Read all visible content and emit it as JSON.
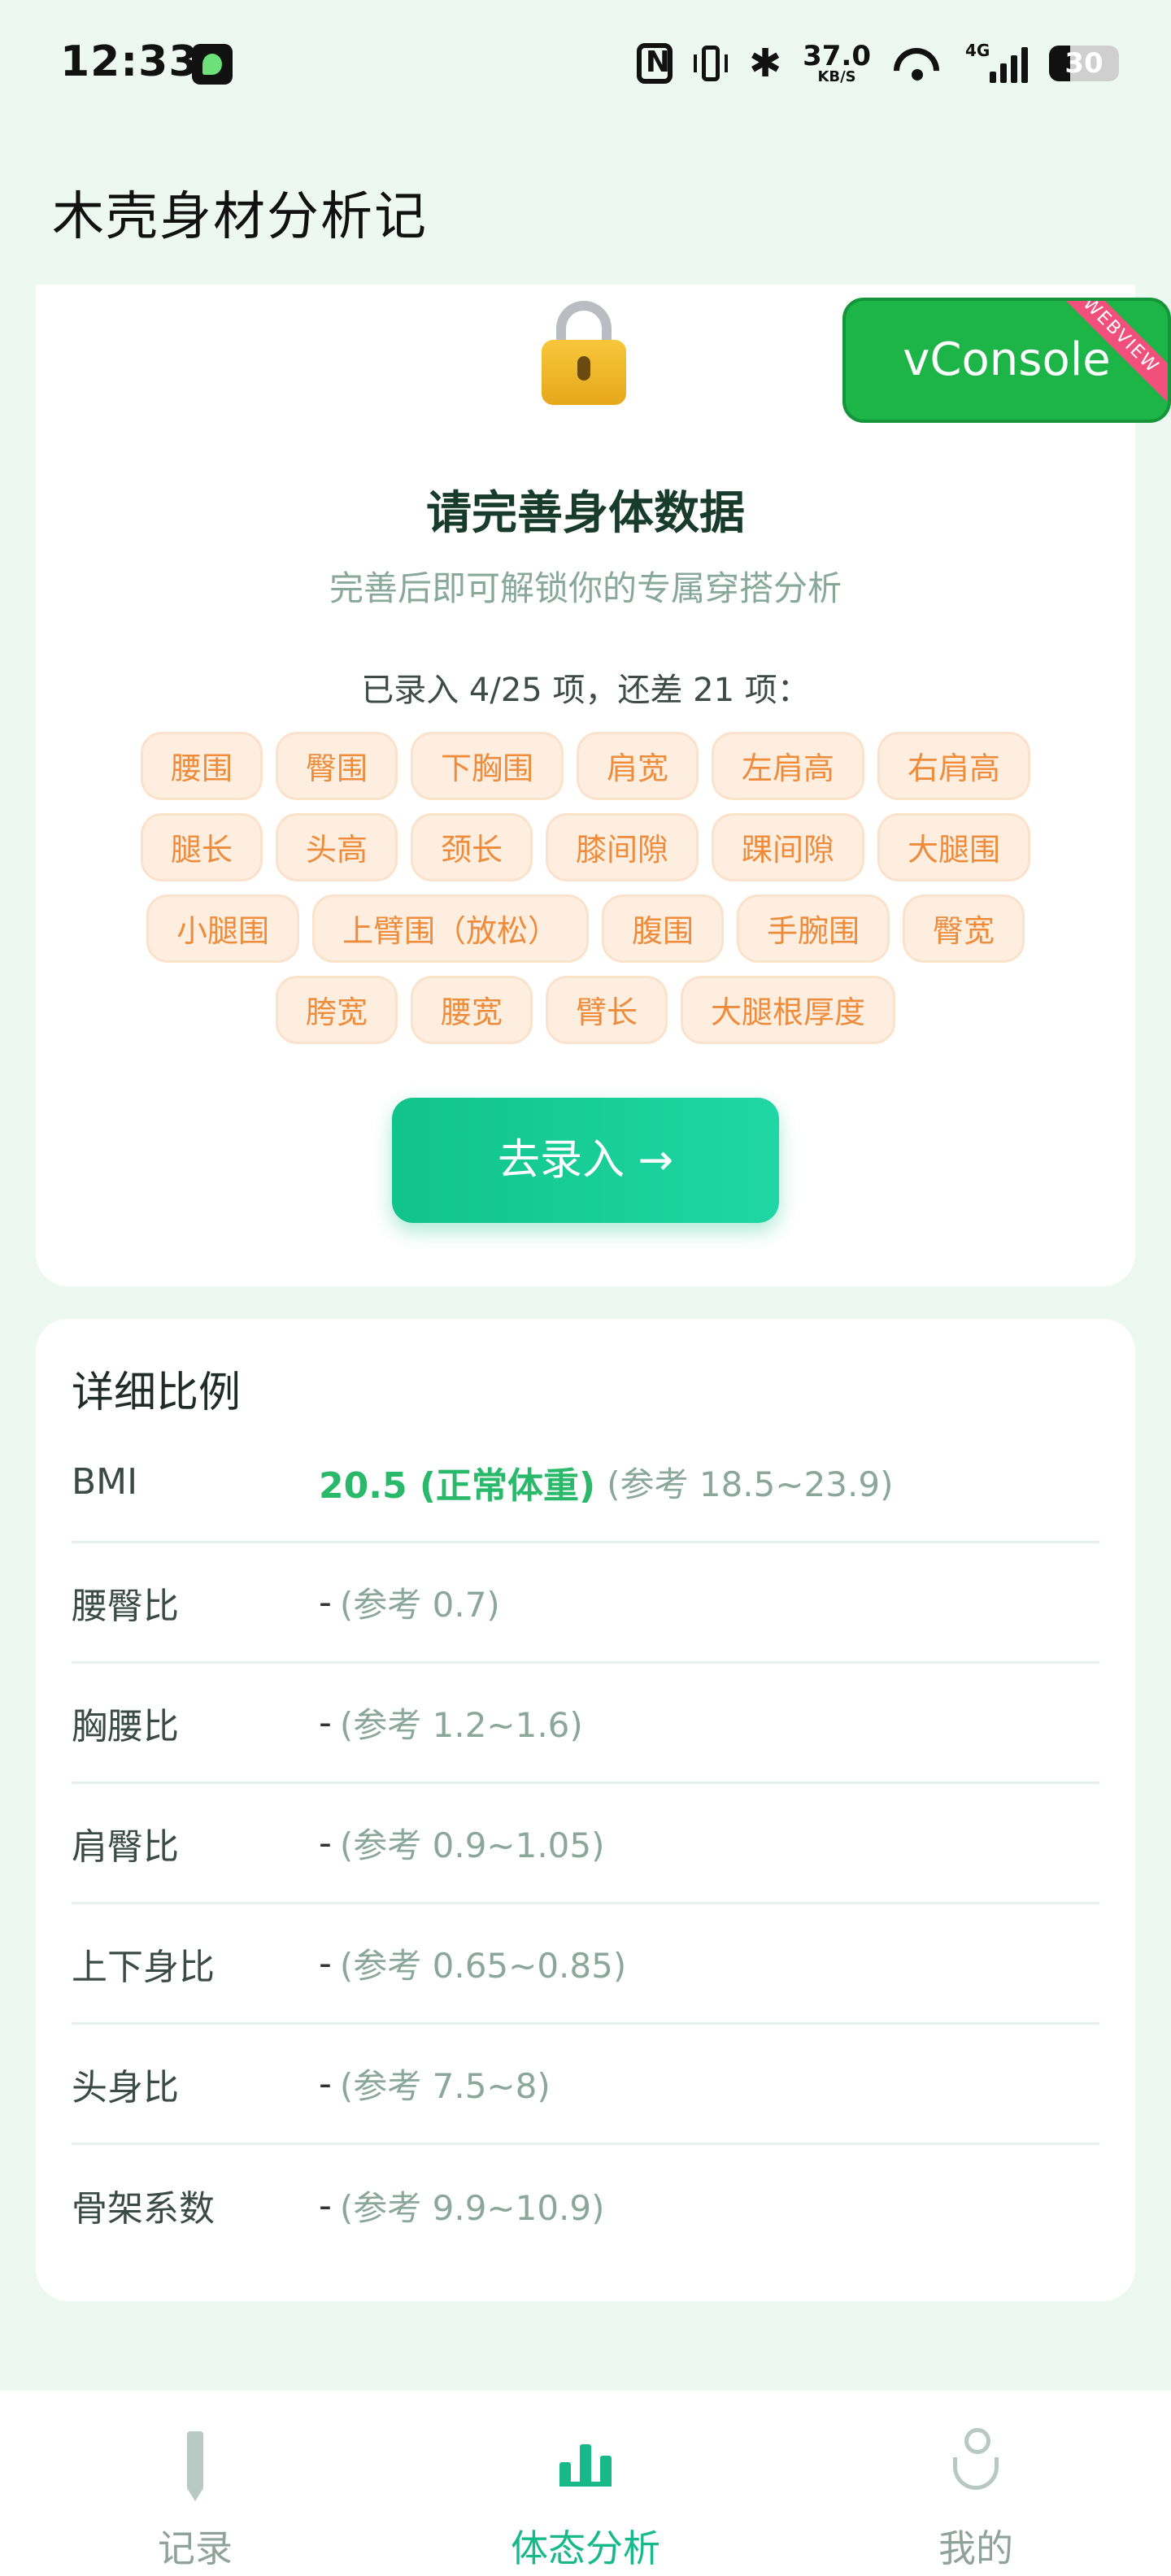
{
  "status_bar": {
    "time": "12:33",
    "net_speed_value": "37.0",
    "net_speed_unit": "KB/S",
    "network_type": "4G",
    "battery": "30"
  },
  "app": {
    "title": "木壳身材分析记"
  },
  "unlock_card": {
    "heading": "请完善身体数据",
    "subtitle": "完善后即可解锁你的专属穿搭分析",
    "progress": "已录入 4/25 项，还差 21 项：",
    "missing_items": [
      "腰围",
      "臀围",
      "下胸围",
      "肩宽",
      "左肩高",
      "右肩高",
      "腿长",
      "头高",
      "颈长",
      "膝间隙",
      "踝间隙",
      "大腿围",
      "小腿围",
      "上臂围（放松）",
      "腹围",
      "手腕围",
      "臀宽",
      "胯宽",
      "腰宽",
      "臂长",
      "大腿根厚度"
    ],
    "button_label": "去录入 →"
  },
  "vconsole": {
    "label": "vConsole",
    "ribbon": "WEBVIEW"
  },
  "ratios": {
    "title": "详细比例",
    "rows": [
      {
        "label": "BMI",
        "value": "20.5 (正常体重)",
        "ref": "(参考 18.5~23.9)"
      },
      {
        "label": "腰臀比",
        "value": "-",
        "ref": "(参考 0.7)"
      },
      {
        "label": "胸腰比",
        "value": "-",
        "ref": "(参考 1.2~1.6)"
      },
      {
        "label": "肩臀比",
        "value": "-",
        "ref": "(参考 0.9~1.05)"
      },
      {
        "label": "上下身比",
        "value": "-",
        "ref": "(参考 0.65~0.85)"
      },
      {
        "label": "头身比",
        "value": "-",
        "ref": "(参考 7.5~8)"
      },
      {
        "label": "骨架系数",
        "value": "-",
        "ref": "(参考 9.9~10.9)"
      }
    ]
  },
  "bottom_nav": {
    "items": [
      {
        "label": "记录",
        "icon": "pen-icon",
        "active": false
      },
      {
        "label": "体态分析",
        "icon": "bar-chart-icon",
        "active": true
      },
      {
        "label": "我的",
        "icon": "user-icon",
        "active": false
      }
    ]
  },
  "colors": {
    "accent": "#17b98a",
    "tag_text": "#ee8c3b",
    "tag_bg": "#fdeee0",
    "bmi_green": "#2ab86a",
    "vconsole_green": "#1db547",
    "background": "#eef8f3"
  }
}
